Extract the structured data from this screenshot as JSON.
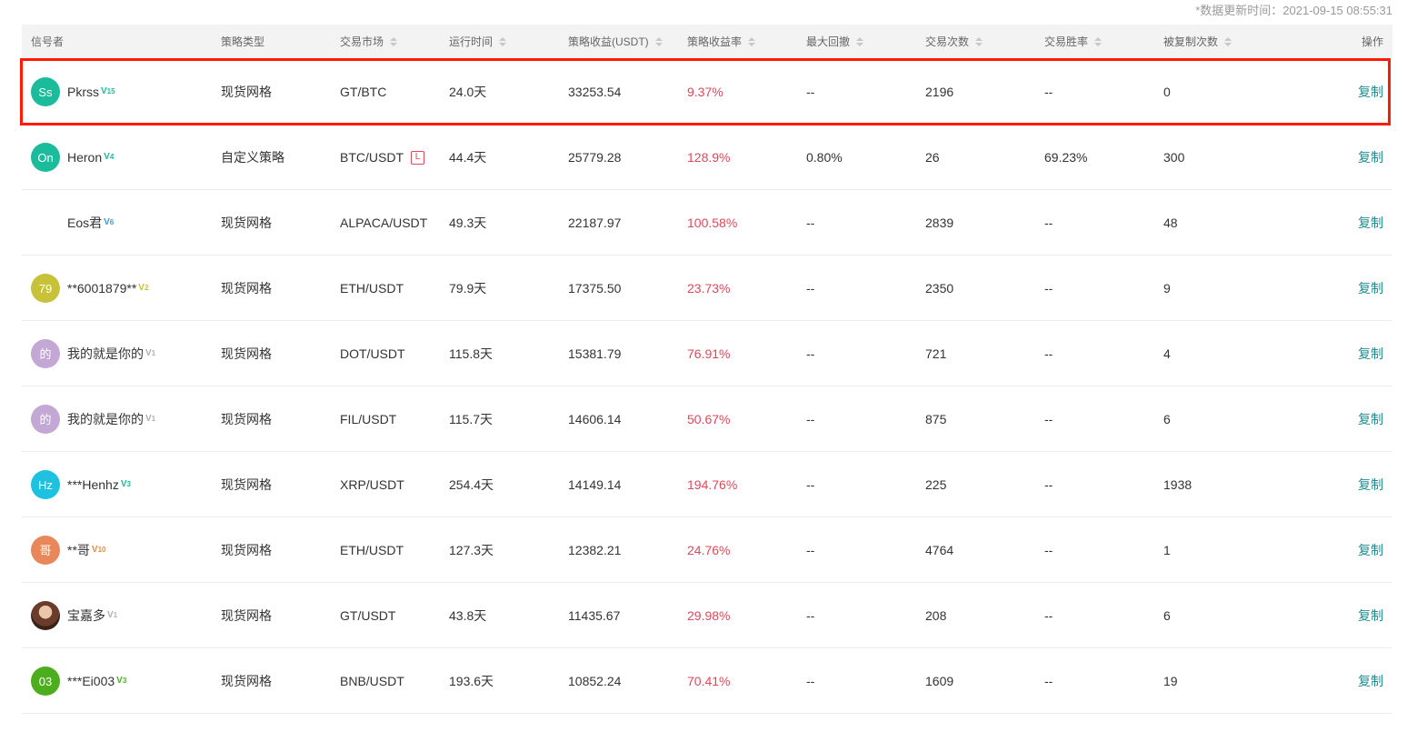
{
  "update_time": "*数据更新时间：2021-09-15 08:55:31",
  "columns": {
    "signaler": "信号者",
    "strategy_type": "策略类型",
    "market": "交易市场",
    "runtime": "运行时间",
    "profit": "策略收益(USDT)",
    "profit_rate": "策略收益率",
    "max_drawdown": "最大回撤",
    "trade_count": "交易次数",
    "win_rate": "交易胜率",
    "copied_count": "被复制次数",
    "action": "操作"
  },
  "rows": [
    {
      "avatar": "Ss",
      "avatar_color": "#1abc9c",
      "name": "Pkrss",
      "level": "15",
      "level_color": "#1abc9c",
      "type": "现货网格",
      "market": "GT/BTC",
      "l_badge": "",
      "runtime": "24.0天",
      "profit": "33253.54",
      "rate": "9.37%",
      "drawdown": "--",
      "trades": "2196",
      "win": "--",
      "copied": "0",
      "action": "复制"
    },
    {
      "avatar": "On",
      "avatar_color": "#1abc9c",
      "name": "Heron",
      "level": "4",
      "level_color": "#1abc9c",
      "type": "自定义策略",
      "market": "BTC/USDT",
      "l_badge": "L",
      "runtime": "44.4天",
      "profit": "25779.28",
      "rate": "128.9%",
      "drawdown": "0.80%",
      "trades": "26",
      "win": "69.23%",
      "copied": "300",
      "action": "复制"
    },
    {
      "avatar": "",
      "avatar_color": "",
      "name": "Eos君",
      "level": "6",
      "level_color": "#3b9be0",
      "type": "现货网格",
      "market": "ALPACA/USDT",
      "l_badge": "",
      "runtime": "49.3天",
      "profit": "22187.97",
      "rate": "100.58%",
      "drawdown": "--",
      "trades": "2839",
      "win": "--",
      "copied": "48",
      "action": "复制"
    },
    {
      "avatar": "79",
      "avatar_color": "#c8c23a",
      "name": "**6001879**",
      "level": "2",
      "level_color": "#c8c23a",
      "type": "现货网格",
      "market": "ETH/USDT",
      "l_badge": "",
      "runtime": "79.9天",
      "profit": "17375.50",
      "rate": "23.73%",
      "drawdown": "--",
      "trades": "2350",
      "win": "--",
      "copied": "9",
      "action": "复制"
    },
    {
      "avatar": "的",
      "avatar_color": "#c3a8d6",
      "name": "我的就是你的",
      "level": "1",
      "level_color": "#b0b0b0",
      "type": "现货网格",
      "market": "DOT/USDT",
      "l_badge": "",
      "runtime": "115.8天",
      "profit": "15381.79",
      "rate": "76.91%",
      "drawdown": "--",
      "trades": "721",
      "win": "--",
      "copied": "4",
      "action": "复制"
    },
    {
      "avatar": "的",
      "avatar_color": "#c3a8d6",
      "name": "我的就是你的",
      "level": "1",
      "level_color": "#b0b0b0",
      "type": "现货网格",
      "market": "FIL/USDT",
      "l_badge": "",
      "runtime": "115.7天",
      "profit": "14606.14",
      "rate": "50.67%",
      "drawdown": "--",
      "trades": "875",
      "win": "--",
      "copied": "6",
      "action": "复制"
    },
    {
      "avatar": "Hz",
      "avatar_color": "#1ec2e0",
      "name": "***Henhz",
      "level": "3",
      "level_color": "#1abc9c",
      "type": "现货网格",
      "market": "XRP/USDT",
      "l_badge": "",
      "runtime": "254.4天",
      "profit": "14149.14",
      "rate": "194.76%",
      "drawdown": "--",
      "trades": "225",
      "win": "--",
      "copied": "1938",
      "action": "复制"
    },
    {
      "avatar": "哥",
      "avatar_color": "#e8875a",
      "name": "**哥",
      "level": "10",
      "level_color": "#f0883a",
      "type": "现货网格",
      "market": "ETH/USDT",
      "l_badge": "",
      "runtime": "127.3天",
      "profit": "12382.21",
      "rate": "24.76%",
      "drawdown": "--",
      "trades": "4764",
      "win": "--",
      "copied": "1",
      "action": "复制"
    },
    {
      "avatar": "",
      "avatar_color": "photo",
      "name": "宝嘉多",
      "level": "1",
      "level_color": "#b0b0b0",
      "type": "现货网格",
      "market": "GT/USDT",
      "l_badge": "",
      "runtime": "43.8天",
      "profit": "11435.67",
      "rate": "29.98%",
      "drawdown": "--",
      "trades": "208",
      "win": "--",
      "copied": "6",
      "action": "复制"
    },
    {
      "avatar": "03",
      "avatar_color": "#4cae1c",
      "name": "***Ei003",
      "level": "3",
      "level_color": "#4cae1c",
      "type": "现货网格",
      "market": "BNB/USDT",
      "l_badge": "",
      "runtime": "193.6天",
      "profit": "10852.24",
      "rate": "70.41%",
      "drawdown": "--",
      "trades": "1609",
      "win": "--",
      "copied": "19",
      "action": "复制"
    }
  ]
}
